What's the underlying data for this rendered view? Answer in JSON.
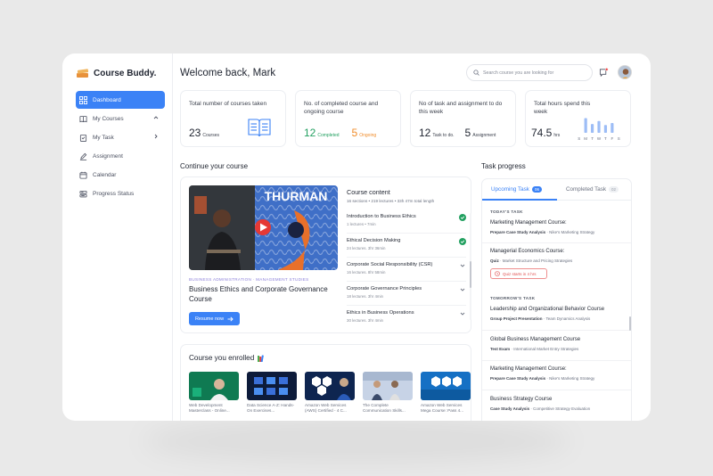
{
  "app": {
    "name": "Course Buddy."
  },
  "sidebar": {
    "items": [
      {
        "label": "Dashboard",
        "icon": "grid-icon",
        "active": true
      },
      {
        "label": "My Courses",
        "icon": "book-icon",
        "chevron": "up"
      },
      {
        "label": "My Task",
        "icon": "clipboard-icon",
        "chevron": "right"
      },
      {
        "label": "Assignment",
        "icon": "pencil-icon"
      },
      {
        "label": "Calendar",
        "icon": "calendar-icon"
      },
      {
        "label": "Progress Status",
        "icon": "progress-icon"
      }
    ]
  },
  "header": {
    "title": "Welcome back, Mark",
    "search_placeholder": "Search course you are looking for"
  },
  "stats": {
    "total_courses": {
      "label": "Total number of courses taken",
      "value": "23",
      "unit": "Courses"
    },
    "completed": {
      "label": "No. of completed course and ongoing course",
      "completed_value": "12",
      "completed_label": "Completed",
      "ongoing_value": "5",
      "ongoing_label": "Ongoing"
    },
    "tasks": {
      "label": "No of task and assignment to do this week",
      "task_value": "12",
      "task_label": "Task to do.",
      "assign_value": "5",
      "assign_label": "Assignment"
    },
    "hours": {
      "label": "Total hours spend this week",
      "value": "74.5",
      "unit": "hrs",
      "days": [
        "S",
        "M",
        "T",
        "W",
        "T",
        "F",
        "S"
      ],
      "day_levels": [
        0.0,
        0.75,
        0.45,
        0.6,
        0.4,
        0.5,
        0.0
      ]
    }
  },
  "continue": {
    "section_title": "Continue your course",
    "video_banner": "THURMAN",
    "category": "BUSINESS ADMINISTRATION · MANAGEMENT STUDIES",
    "course_title": "Business Ethics and Corporate Governance Course",
    "resume_label": "Resume now",
    "content_title": "Course content",
    "content_meta": "16 sections • 219 lectures • 33h 47m total length",
    "lectures": [
      {
        "title": "Introduction to Business Ethics",
        "meta": "1 lectures • 7min",
        "done": true
      },
      {
        "title": "Ethical Decision Making",
        "meta": "24 lectures. 3hr 36min",
        "done": true
      },
      {
        "title": "Corporate Social Responsibility (CSR)",
        "meta": "16 lectures. 8hr 58min",
        "done": false
      },
      {
        "title": "Corporate Governance Principles",
        "meta": "18 lectures. 3hr 4min",
        "done": false
      },
      {
        "title": "Ethics in Business Operations",
        "meta": "30 lectures. 3hr 4min",
        "done": false
      }
    ]
  },
  "enrolled": {
    "title": "Course you enrolled",
    "courses": [
      {
        "caption": "Web Development Masterclass - Online..."
      },
      {
        "caption": "Data Science A-Z: Hands-On Exercises..."
      },
      {
        "caption": "Amazon Web Services (AWS) Certified - 4 C..."
      },
      {
        "caption": "The Complete Communication Skills..."
      },
      {
        "caption": "Amazon Web Services Mega Course: Pass 4..."
      }
    ]
  },
  "task_progress": {
    "title": "Task progress",
    "tabs": [
      {
        "label": "Upcoming Task",
        "count": "06",
        "active": true
      },
      {
        "label": "Completed Task",
        "count": "02",
        "active": false
      }
    ],
    "today_label": "TODAY'S TASK",
    "tomorrow_label": "TOMORROW'S TASK",
    "today": [
      {
        "title": "Marketing Management Course:",
        "type": "Prepare Case Study Analysis",
        "detail": "Nike's Marketing Strategy"
      },
      {
        "title": "Managerial Economics Course:",
        "type": "Quiz",
        "detail": "Market Structure and Pricing Strategies",
        "chip": "Quiz starts in 4 hrs"
      }
    ],
    "tomorrow": [
      {
        "title": "Leadership and Organizational Behavior Course",
        "type": "Group Project Presentation",
        "detail": "Team Dynamics Analysis"
      },
      {
        "title": "Global Business Management Course",
        "type": "Test Exam",
        "detail": "International Market Entry Strategies"
      },
      {
        "title": "Marketing Management Course:",
        "type": "Prepare Case Study Analysis",
        "detail": "Nike's Marketing Strategy"
      },
      {
        "title": "Business Strategy Course",
        "type": "Case Study Analysis",
        "detail": "Competitive Strategy Evaluation"
      }
    ]
  },
  "colors": {
    "accent": "#3b82f6",
    "completed": "#22a060",
    "ongoing": "#f08c2a",
    "bar": "#9dbdf6"
  }
}
